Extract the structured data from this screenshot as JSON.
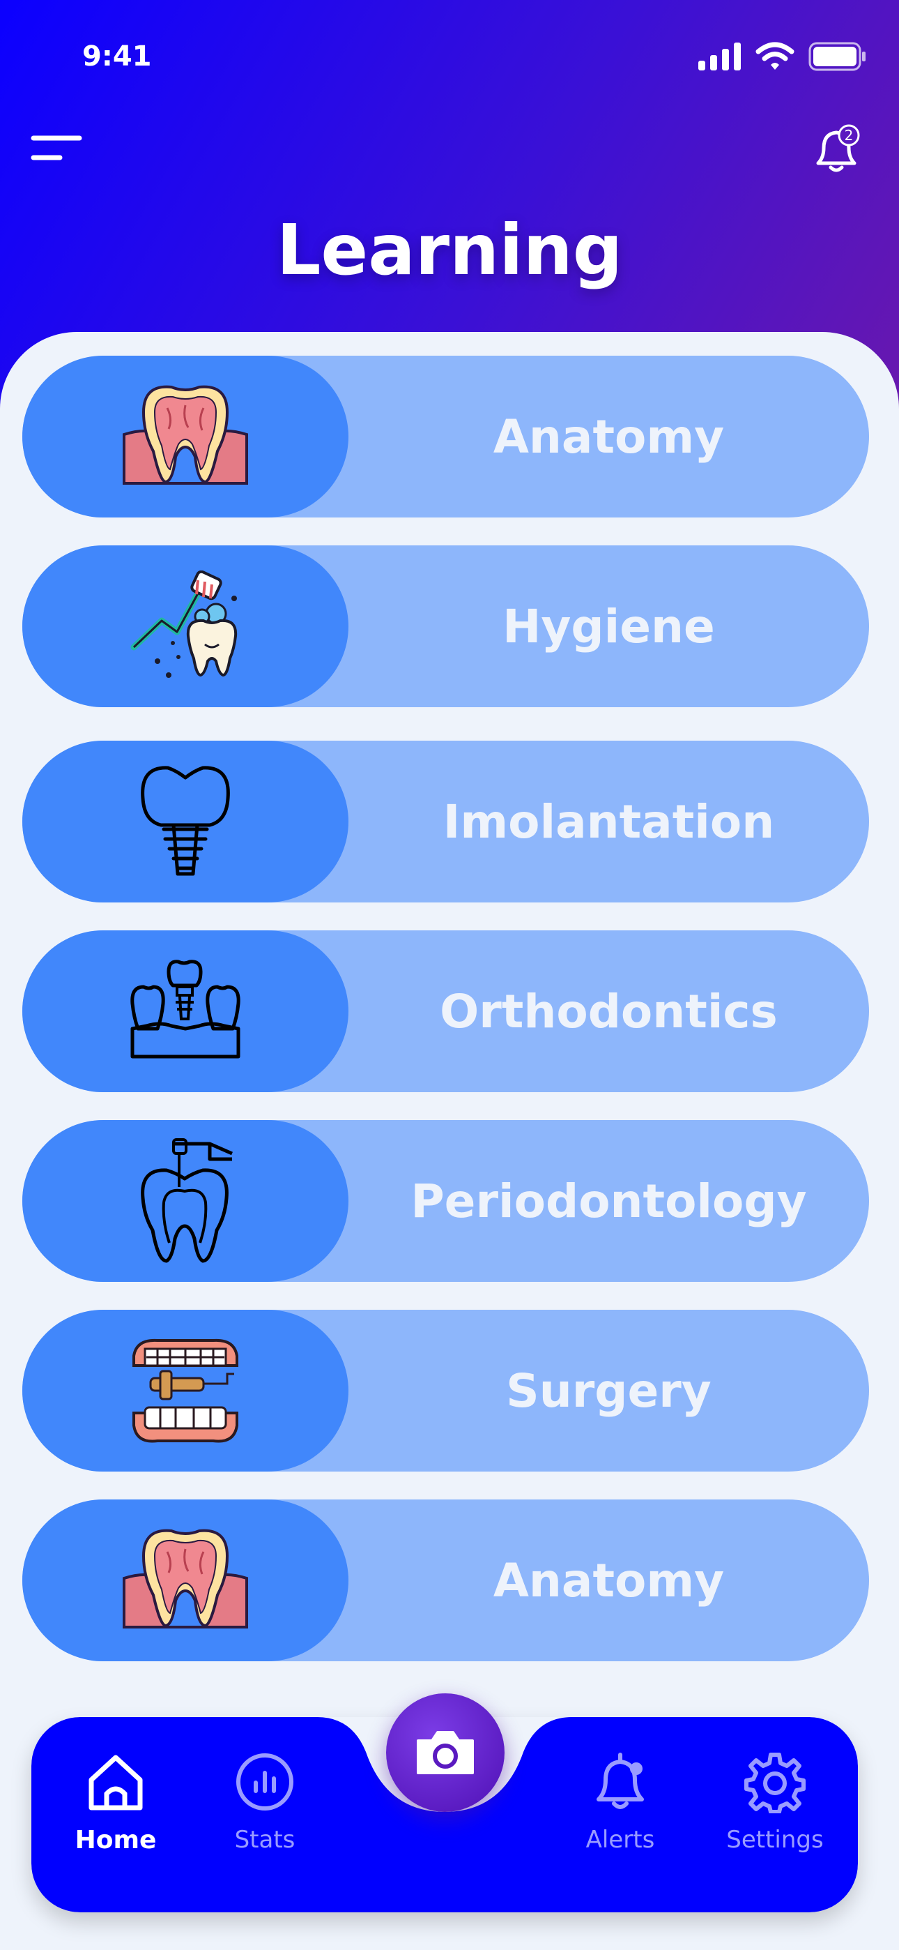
{
  "status_bar": {
    "time": "9:41"
  },
  "header": {
    "title": "Learning",
    "notification_count": "2"
  },
  "cards": [
    {
      "label": "Anatomy",
      "icon": "tooth-anatomy-icon"
    },
    {
      "label": "Hygiene",
      "icon": "toothbrush-icon"
    },
    {
      "label": "Imolantation",
      "icon": "dental-implant-icon"
    },
    {
      "label": "Orthodontics",
      "icon": "dental-bridge-icon"
    },
    {
      "label": "Periodontology",
      "icon": "root-canal-icon"
    },
    {
      "label": "Surgery",
      "icon": "dental-drill-icon"
    },
    {
      "label": "Anatomy",
      "icon": "tooth-anatomy-icon"
    }
  ],
  "nav": {
    "home": "Home",
    "stats": "Stats",
    "alerts": "Alerts",
    "settings": "Settings"
  },
  "colors": {
    "header_gradient": [
      "#0b00ff",
      "#6a18ad"
    ],
    "card_bg": "#8db6fb",
    "card_icon_bg": "#4187fb",
    "nav_bg": "#0000ff",
    "fab": "#5a1ac0"
  }
}
